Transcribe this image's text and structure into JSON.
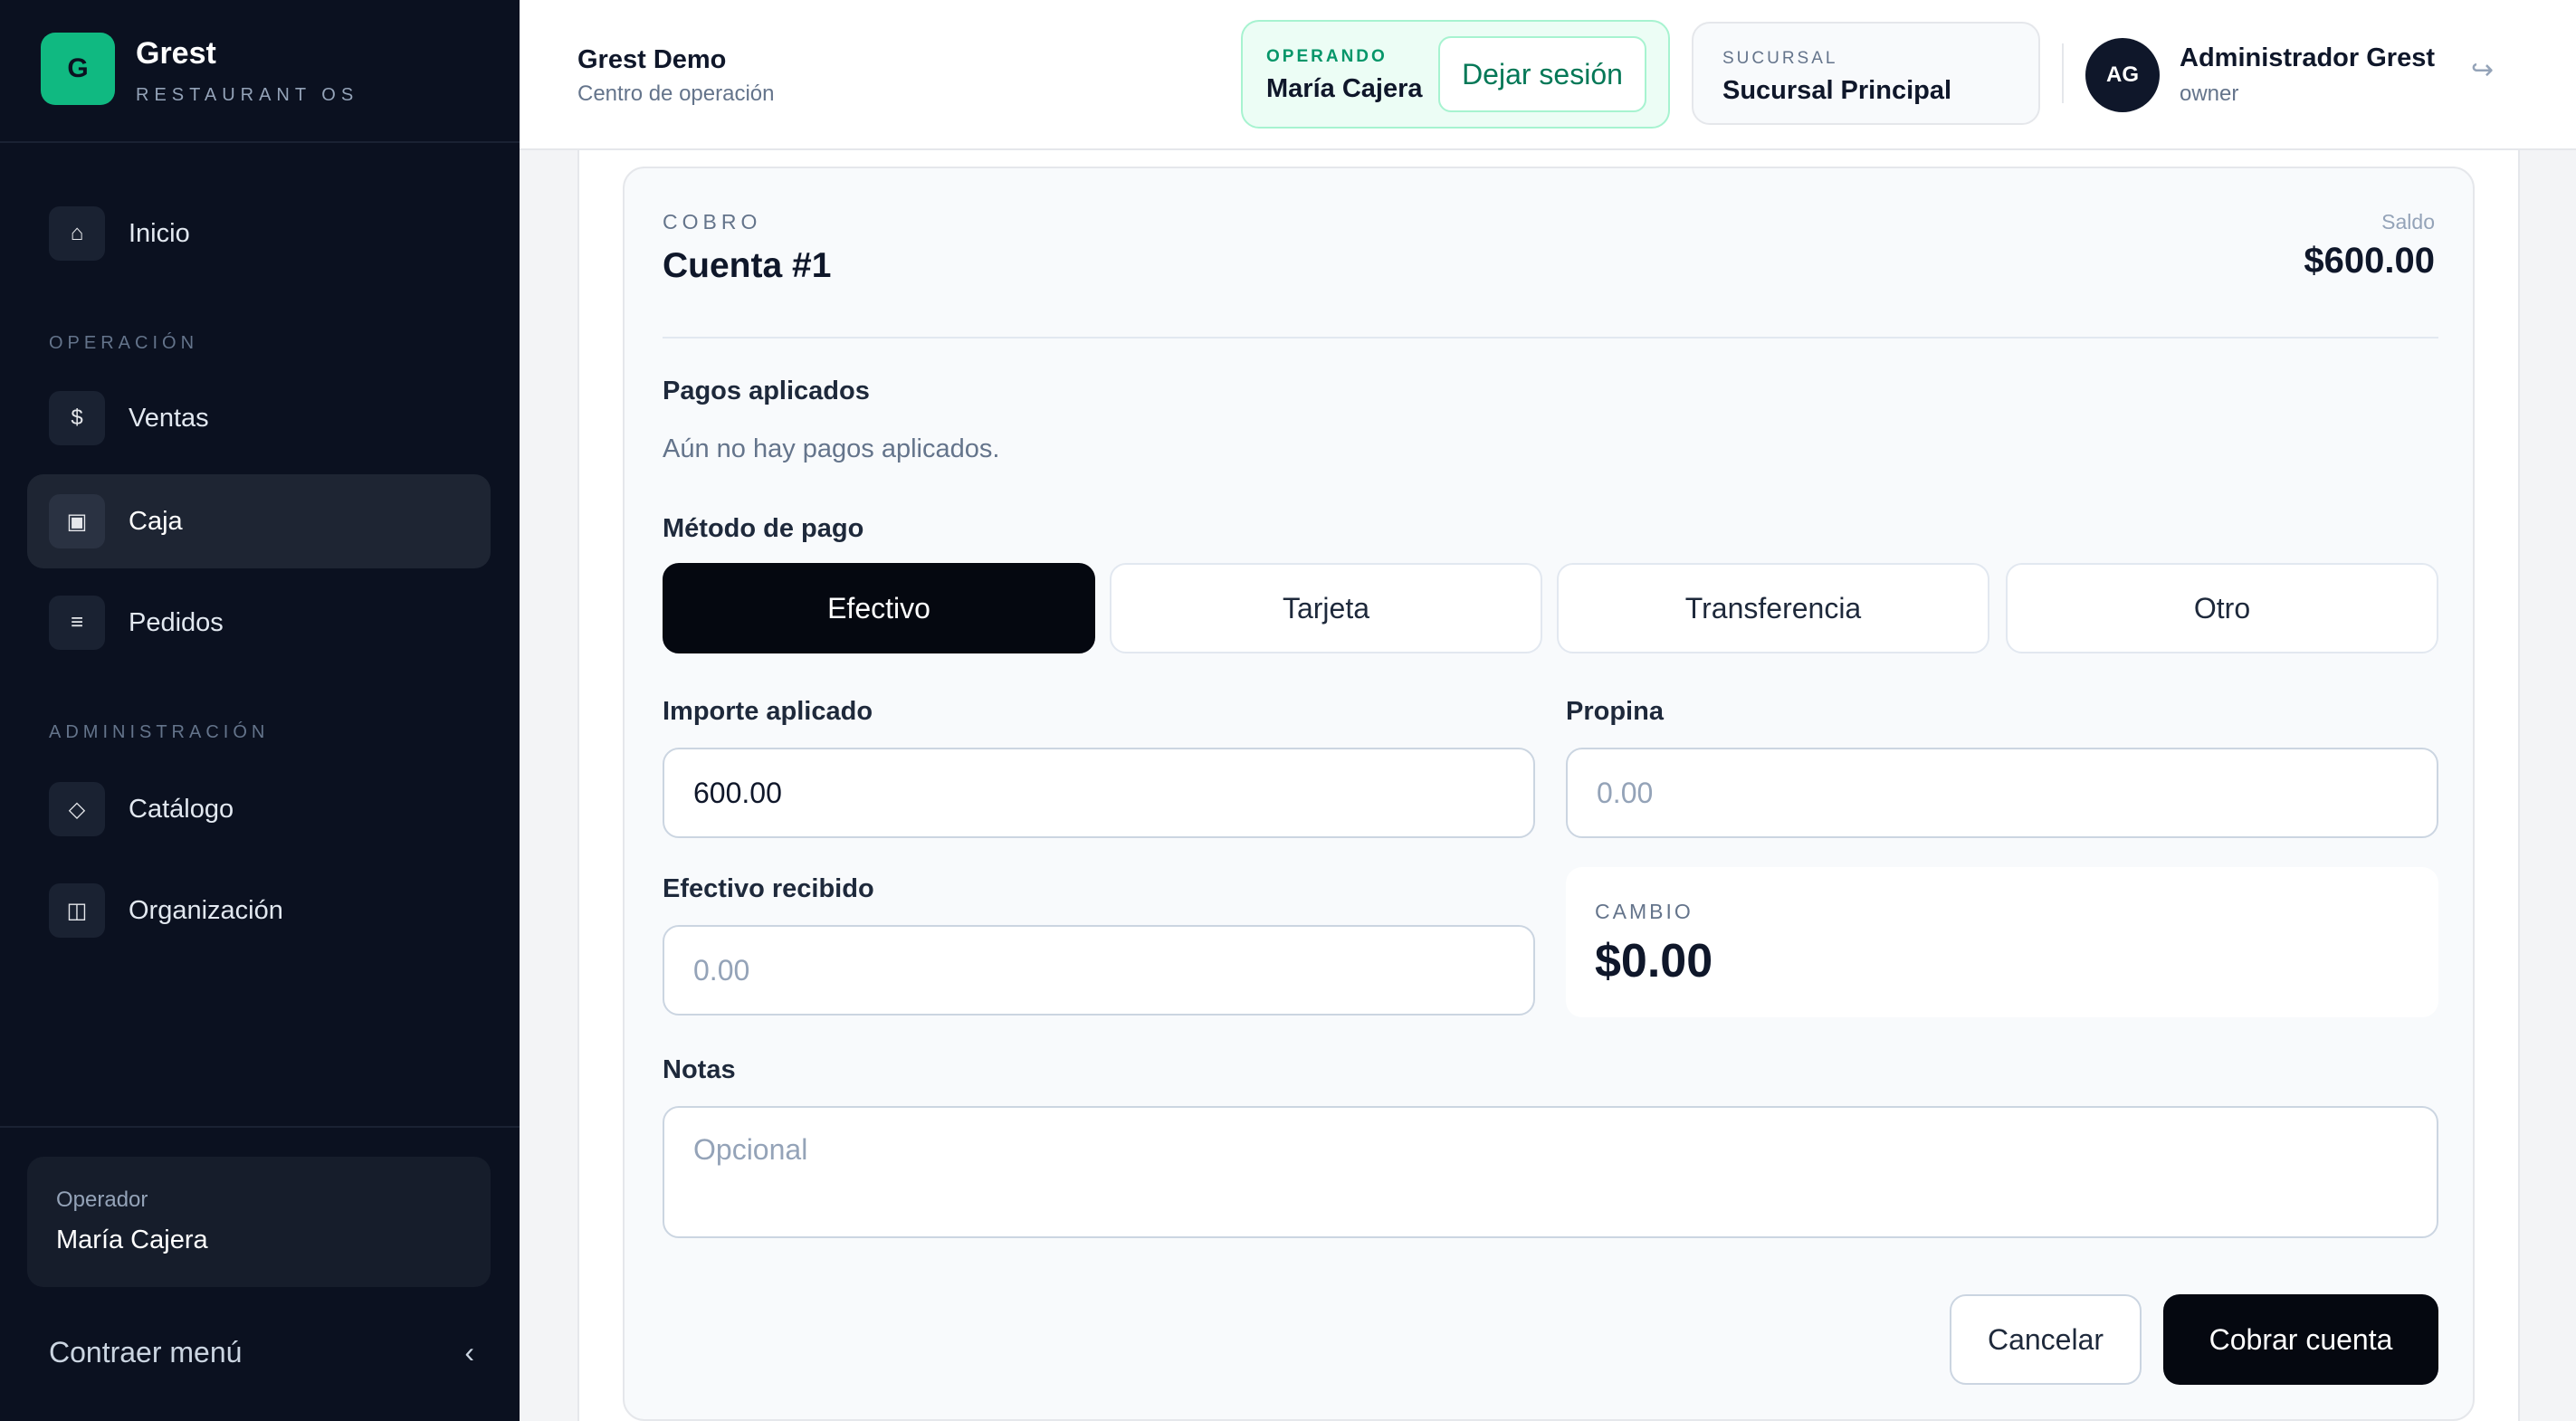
{
  "app": {
    "brand_initial": "G",
    "brand_name": "Grest",
    "brand_sub": "RESTAURANT OS",
    "accent_color": "#10b981"
  },
  "sidebar": {
    "items_top": [
      {
        "label": "Inicio",
        "icon": "home-icon",
        "glyph": "⌂"
      }
    ],
    "section_operation": "OPERACIÓN",
    "items_operation": [
      {
        "label": "Ventas",
        "icon": "dollar-icon",
        "glyph": "$"
      },
      {
        "label": "Caja",
        "icon": "register-icon",
        "glyph": "▣",
        "active": true
      },
      {
        "label": "Pedidos",
        "icon": "list-icon",
        "glyph": "≡"
      }
    ],
    "section_admin": "ADMINISTRACIÓN",
    "items_admin": [
      {
        "label": "Catálogo",
        "icon": "tag-icon",
        "glyph": "◇"
      },
      {
        "label": "Organización",
        "icon": "building-icon",
        "glyph": "◫"
      }
    ],
    "operator_label": "Operador",
    "operator_name": "María Cajera",
    "collapse_label": "Contraer menú",
    "collapse_glyph": "‹"
  },
  "header": {
    "org_name": "Grest Demo",
    "org_sub": "Centro de operación",
    "operating_label": "OPERANDO",
    "operating_name": "María Cajera",
    "leave_label": "Dejar sesión",
    "branch_label": "SUCURSAL",
    "branch_name": "Sucursal Principal",
    "avatar_initials": "AG",
    "user_name": "Administrador Grest",
    "user_role": "owner",
    "logout_glyph": "↪"
  },
  "payment": {
    "eyebrow": "COBRO",
    "title": "Cuenta #1",
    "balance_label": "Saldo",
    "balance_value": "$600.00",
    "applied_title": "Pagos aplicados",
    "applied_empty": "Aún no hay pagos aplicados.",
    "method_title": "Método de pago",
    "methods": [
      "Efectivo",
      "Tarjeta",
      "Transferencia",
      "Otro"
    ],
    "selected_method": "Efectivo",
    "amount_label": "Importe aplicado",
    "amount_value": "600.00",
    "tip_label": "Propina",
    "tip_placeholder": "0.00",
    "cash_label": "Efectivo recibido",
    "cash_placeholder": "0.00",
    "change_label": "CAMBIO",
    "change_value": "$0.00",
    "notes_label": "Notas",
    "notes_placeholder": "Opcional",
    "cancel_label": "Cancelar",
    "charge_label": "Cobrar cuenta"
  }
}
